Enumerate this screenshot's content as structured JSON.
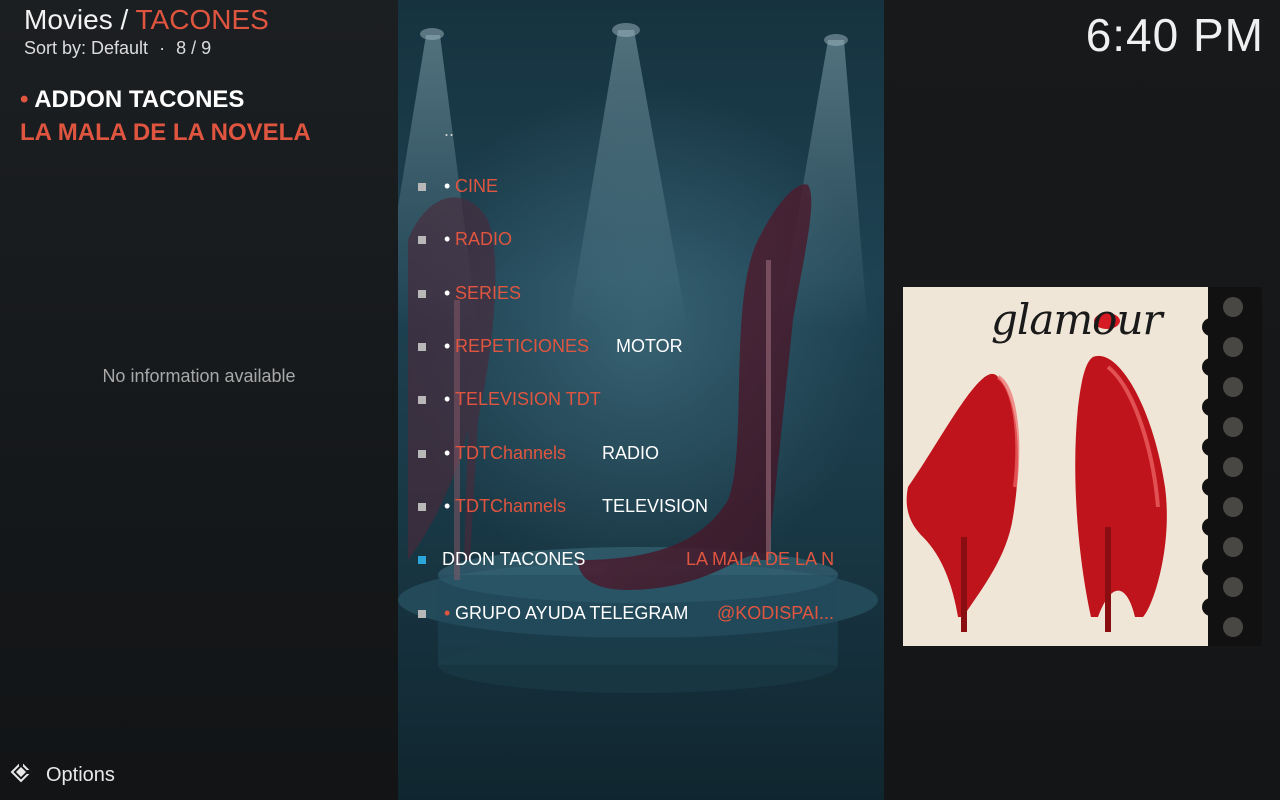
{
  "header": {
    "section": "Movies / ",
    "addon": "TACONES",
    "sort_label": "Sort by: Default",
    "separator": "·",
    "position": "8 / 9"
  },
  "clock": "6:40 PM",
  "info": {
    "title_bullet": "•",
    "title_line1": "ADDON TACONES",
    "title_line2": "LA MALA DE LA NOVELA",
    "no_info": "No information available"
  },
  "list": {
    "parent": "..",
    "items": [
      {
        "bullet": "•",
        "label": "CINE",
        "extra": ""
      },
      {
        "bullet": "•",
        "label": "RADIO",
        "extra": ""
      },
      {
        "bullet": "•",
        "label": "SERIES",
        "extra": ""
      },
      {
        "bullet": "•",
        "label": "REPETICIONES",
        "extra": "MOTOR"
      },
      {
        "bullet": "•",
        "label": "TELEVISION TDT",
        "extra": ""
      },
      {
        "bullet": "•",
        "label": "TDTChannels",
        "extra": "RADIO"
      },
      {
        "bullet": "•",
        "label": "TDTChannels",
        "extra": "TELEVISION"
      },
      {
        "bullet": "",
        "label": "DDON TACONES",
        "extra": "LA MALA DE LA N"
      },
      {
        "bullet": "•",
        "label": "GRUPO AYUDA TELEGRAM",
        "extra": "@KODISPAI..."
      }
    ]
  },
  "poster": {
    "text": "glamour",
    "description": "Red high heels on lace background"
  },
  "footer": {
    "options_label": "Options",
    "options_icon": "options-icon"
  },
  "colors": {
    "accent": "#e0553f",
    "focus": "#2aa7d8",
    "text": "#ffffff"
  }
}
